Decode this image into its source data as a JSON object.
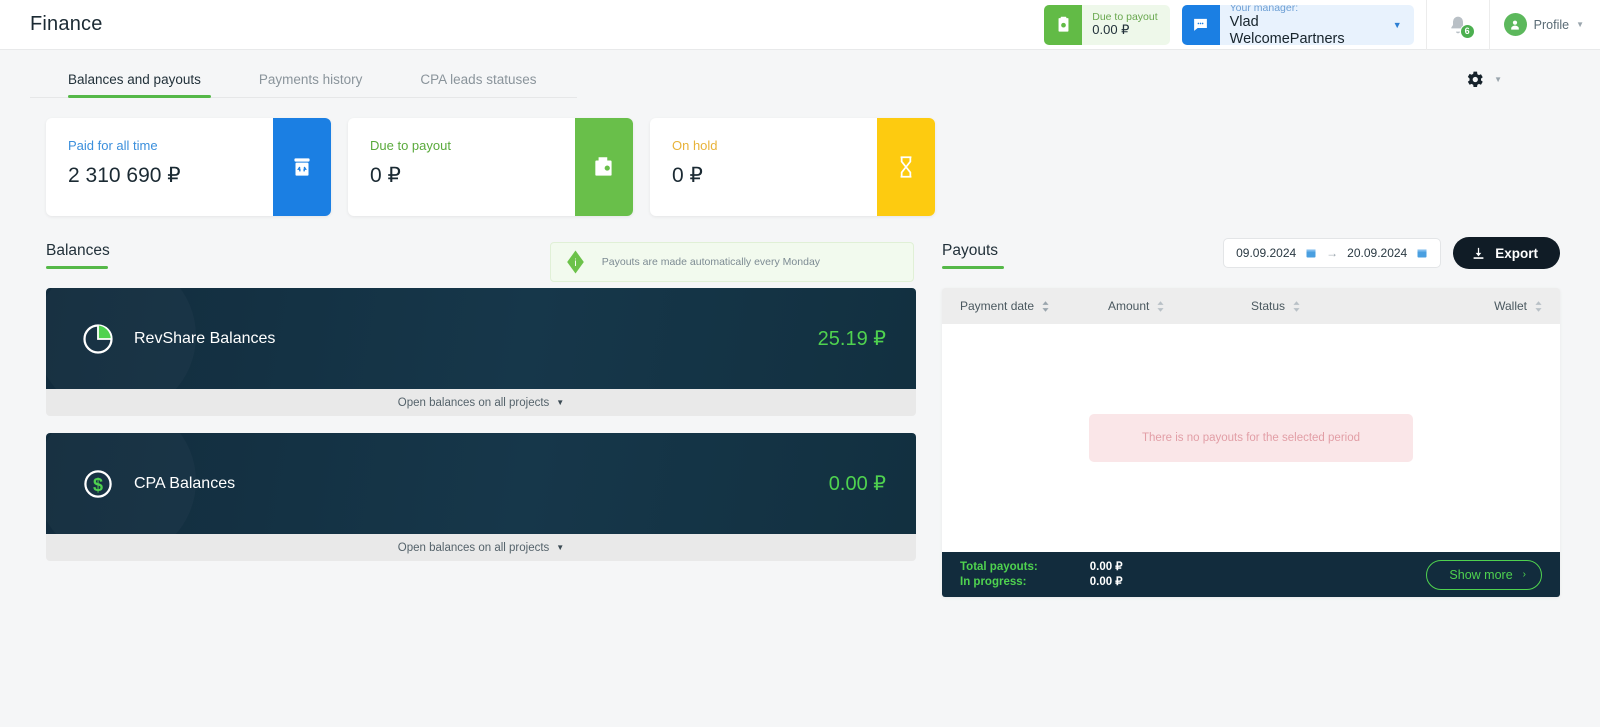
{
  "header": {
    "title": "Finance",
    "due_pill": {
      "label": "Due to payout",
      "value": "0.00 ₽"
    },
    "manager_pill": {
      "label": "Your manager:",
      "value": "Vlad WelcomePartners"
    },
    "notifications_count": "6",
    "profile_label": "Profile"
  },
  "tabs": [
    {
      "label": "Balances and payouts",
      "active": true
    },
    {
      "label": "Payments history",
      "active": false
    },
    {
      "label": "CPA leads statuses",
      "active": false
    }
  ],
  "stats": [
    {
      "label": "Paid for all time",
      "value": "2 310 690 ₽",
      "icon": "atm-icon",
      "color": "#1b7fe3"
    },
    {
      "label": "Due to payout",
      "value": "0 ₽",
      "icon": "wallet-icon",
      "color": "#69bf4a"
    },
    {
      "label": "On hold",
      "value": "0 ₽",
      "icon": "hourglass-icon",
      "color": "#fdcb10"
    }
  ],
  "balances": {
    "section_title": "Balances",
    "info_banner": "Payouts are made automatically every Monday",
    "cards": [
      {
        "name": "RevShare Balances",
        "amount": "25.19 ₽",
        "icon": "pie-chart-icon",
        "footer": "Open balances on all projects"
      },
      {
        "name": "CPA Balances",
        "amount": "0.00 ₽",
        "icon": "dollar-circle-icon",
        "footer": "Open balances on all projects"
      }
    ]
  },
  "payouts": {
    "section_title": "Payouts",
    "date_from": "09.09.2024",
    "date_to": "20.09.2024",
    "export_label": "Export",
    "columns": [
      "Payment date",
      "Amount",
      "Status",
      "Wallet"
    ],
    "rows": [],
    "empty_message": "There is no payouts for the selected period",
    "footer": {
      "total_label": "Total payouts:",
      "total_value": "0.00 ₽",
      "progress_label": "In progress:",
      "progress_value": "0.00 ₽",
      "show_more_label": "Show more"
    }
  }
}
